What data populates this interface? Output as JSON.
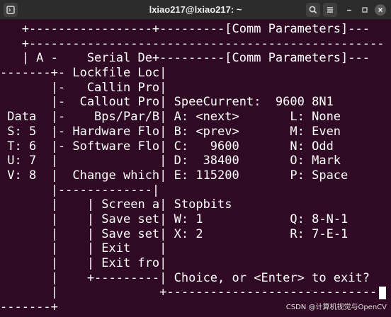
{
  "window": {
    "title": "lxiao217@lxiao217: ~"
  },
  "terminal": {
    "lines": [
      "   +-----------------+---------[Comm Parameters]---",
      "   +-------------------------------------------------",
      "   | A -    Serial De+---------[Comm Parameters]---",
      "-------+- Lockfile Loc|",
      "       |-   Callin Pro|",
      "       |-  Callout Pro| SpeeCurrent:  9600 8N1",
      " Data  |-    Bps/Par/B| A: <next>       L: None",
      " S: 5  |- Hardware Flo| B: <prev>       M: Even",
      " T: 6  |- Software Flo| C:   9600       N: Odd",
      " U: 7  |              | D:  38400       O: Mark",
      " V: 8  |  Change which| E: 115200       P: Space",
      "       |-------------|",
      "       |    | Screen a| Stopbits",
      "       |    | Save set| W: 1            Q: 8-N-1",
      "       |    | Save set| X: 2            R: 7-E-1",
      "       |    | Exit    |",
      "       |    | Exit fro|",
      "       |    +---------| Choice, or <Enter> to exit?",
      "       |              +-----------------------------",
      "-------+"
    ]
  },
  "watermark": "CSDN @计算机视觉与OpenCV",
  "icons": {
    "new_tab": "terminal-tab-icon",
    "search": "search-icon",
    "menu": "hamburger-menu-icon",
    "minimize": "minimize-icon",
    "maximize": "maximize-icon",
    "close": "close-icon"
  },
  "colors": {
    "terminal_background": "#300a24",
    "titlebar_background": "#2c2c2c",
    "text": "#ffffff"
  }
}
